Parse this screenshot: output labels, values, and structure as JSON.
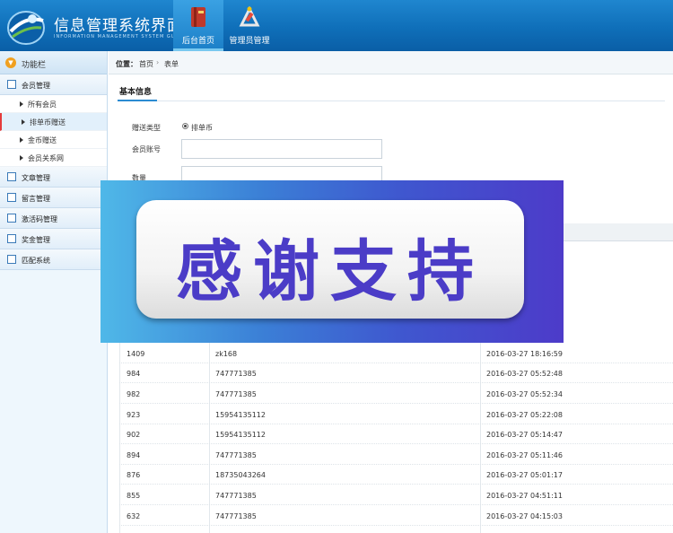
{
  "header": {
    "title": "信息管理系统界面",
    "subtitle": "INFORMATION MANAGEMENT SYSTEM GUI",
    "nav": [
      {
        "label": "后台首页",
        "icon": "book-icon",
        "active": true
      },
      {
        "label": "管理员管理",
        "icon": "tools-icon",
        "active": false
      }
    ]
  },
  "sidebar": {
    "title": "功能栏",
    "groups": [
      {
        "label": "会员管理",
        "items": [
          "所有会员",
          "排单币赠送",
          "金币赠送",
          "会员关系网"
        ]
      },
      {
        "label": "文章管理"
      },
      {
        "label": "留言管理"
      },
      {
        "label": "激活码管理"
      },
      {
        "label": "奖金管理"
      },
      {
        "label": "匹配系统"
      }
    ],
    "active_item": "排单币赠送"
  },
  "breadcrumb": {
    "label": "位置：",
    "items": [
      "首页",
      "表单"
    ]
  },
  "form": {
    "tab": "基本信息",
    "fields": {
      "type_label": "赠送类型",
      "type_option": "排单币",
      "account_label": "会员账号",
      "amount_label": "数量"
    }
  },
  "table": {
    "rows": [
      [
        "1409",
        "zk168",
        "2016-03-27 18:16:59"
      ],
      [
        "984",
        "747771385",
        "2016-03-27 05:52:48"
      ],
      [
        "982",
        "747771385",
        "2016-03-27 05:52:34"
      ],
      [
        "923",
        "15954135112",
        "2016-03-27 05:22:08"
      ],
      [
        "902",
        "15954135112",
        "2016-03-27 05:14:47"
      ],
      [
        "894",
        "747771385",
        "2016-03-27 05:11:46"
      ],
      [
        "876",
        "18735043264",
        "2016-03-27 05:01:17"
      ],
      [
        "855",
        "747771385",
        "2016-03-27 04:51:11"
      ],
      [
        "632",
        "747771385",
        "2016-03-27 04:15:03"
      ]
    ]
  },
  "banner": {
    "text": "感谢支持"
  },
  "colors": {
    "header": "#0f6fb9",
    "banner_text": "#4b3cc7",
    "accent": "#2b8bd2"
  }
}
